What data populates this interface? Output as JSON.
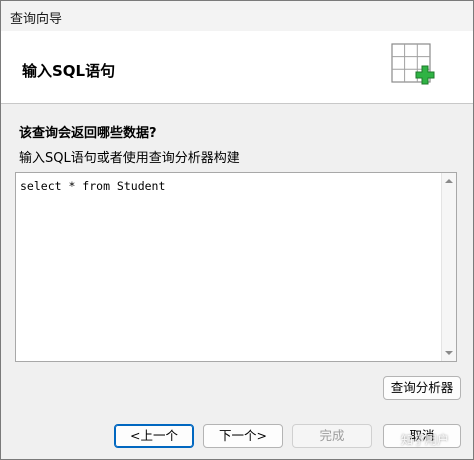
{
  "window": {
    "title": "查询向导"
  },
  "header": {
    "title": "输入SQL语句",
    "icon": "table-add-icon",
    "icon_accent": "#27a83a"
  },
  "body": {
    "question": "该查询会返回哪些数据?",
    "hint": "输入SQL语句或者使用查询分析器构建",
    "sql_value": "select * from Student"
  },
  "buttons": {
    "analyzer": "查询分析器",
    "prev": "<上一个",
    "next": "下一个>",
    "finish": "完成",
    "cancel": "取消"
  },
  "watermark": "知乎用户"
}
